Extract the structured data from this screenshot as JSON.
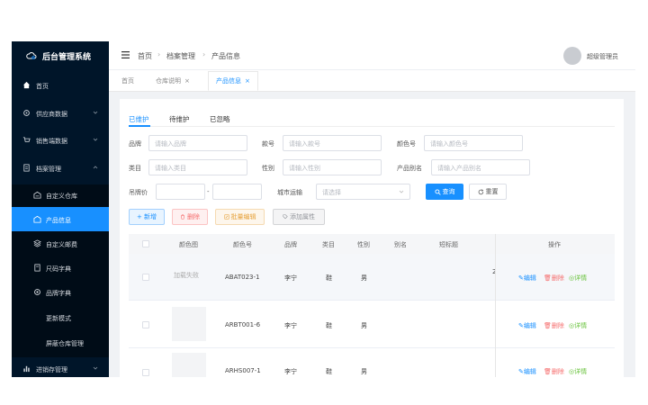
{
  "app": {
    "title": "后台管理系统"
  },
  "sidebar": {
    "items": [
      {
        "label": "首页",
        "icon": "home-icon"
      },
      {
        "label": "供应商数据",
        "icon": "supplier-icon"
      },
      {
        "label": "销售端数据",
        "icon": "cart-icon"
      },
      {
        "label": "档案管理",
        "icon": "archive-icon"
      },
      {
        "label": "自定义仓库",
        "icon": "warehouse-icon"
      },
      {
        "label": "产品信息",
        "icon": "product-icon"
      },
      {
        "label": "自定义邮费",
        "icon": "postage-icon"
      },
      {
        "label": "尺码字典",
        "icon": "size-icon"
      },
      {
        "label": "品牌字典",
        "icon": "brand-icon"
      },
      {
        "label": "更新模式"
      },
      {
        "label": "屏蔽仓库管理"
      },
      {
        "label": "进销存管理",
        "icon": "chart-icon"
      }
    ]
  },
  "header": {
    "breadcrumb": [
      "首页",
      "档案管理",
      "产品信息"
    ],
    "username": "超级管理员"
  },
  "tabs": [
    {
      "label": "首页"
    },
    {
      "label": "仓库说明"
    },
    {
      "label": "产品信息"
    }
  ],
  "subtabs": [
    "已维护",
    "待维护",
    "已忽略"
  ],
  "filters": {
    "brand_label": "品牌",
    "brand_placeholder": "请输入品牌",
    "sku_label": "款号",
    "sku_placeholder": "请输入款号",
    "colorcode_label": "颜色号",
    "colorcode_placeholder": "请输入颜色号",
    "category_label": "类目",
    "category_placeholder": "请输入类目",
    "gender_label": "性别",
    "gender_placeholder": "请输入性别",
    "alias_label": "产品别名",
    "alias_placeholder": "请输入产品别名",
    "price_label": "吊牌价",
    "price_sep": "-",
    "mode_label": "城市运输",
    "mode_placeholder": "请选择"
  },
  "buttons": {
    "query": "查询",
    "reset": "重置",
    "add": "+ 新增",
    "delete": "删除",
    "batch_edit": "批量编辑",
    "add_attr": "添加属性"
  },
  "table": {
    "headers": [
      "颜色图",
      "颜色号",
      "品牌",
      "类目",
      "性别",
      "别名",
      "短标题",
      "操作"
    ],
    "rows": [
      {
        "image": "加载失败",
        "code": "ABAT023-1",
        "brand": "李宁",
        "category": "鞋",
        "gender": "男",
        "extra": "2"
      },
      {
        "image": "",
        "code": "ARBT001-6",
        "brand": "李宁",
        "category": "鞋",
        "gender": "男",
        "extra": ""
      },
      {
        "image": "",
        "code": "ARHS007-1",
        "brand": "李宁",
        "category": "鞋",
        "gender": "男",
        "extra": ""
      }
    ],
    "actions": {
      "edit": "编辑",
      "delete": "删除",
      "detail": "详情"
    }
  },
  "colors": {
    "sidebar_bg": "#001529",
    "accent": "#1890ff",
    "danger": "#f56c6c",
    "success": "#67c23a",
    "warning": "#e6a23c"
  }
}
